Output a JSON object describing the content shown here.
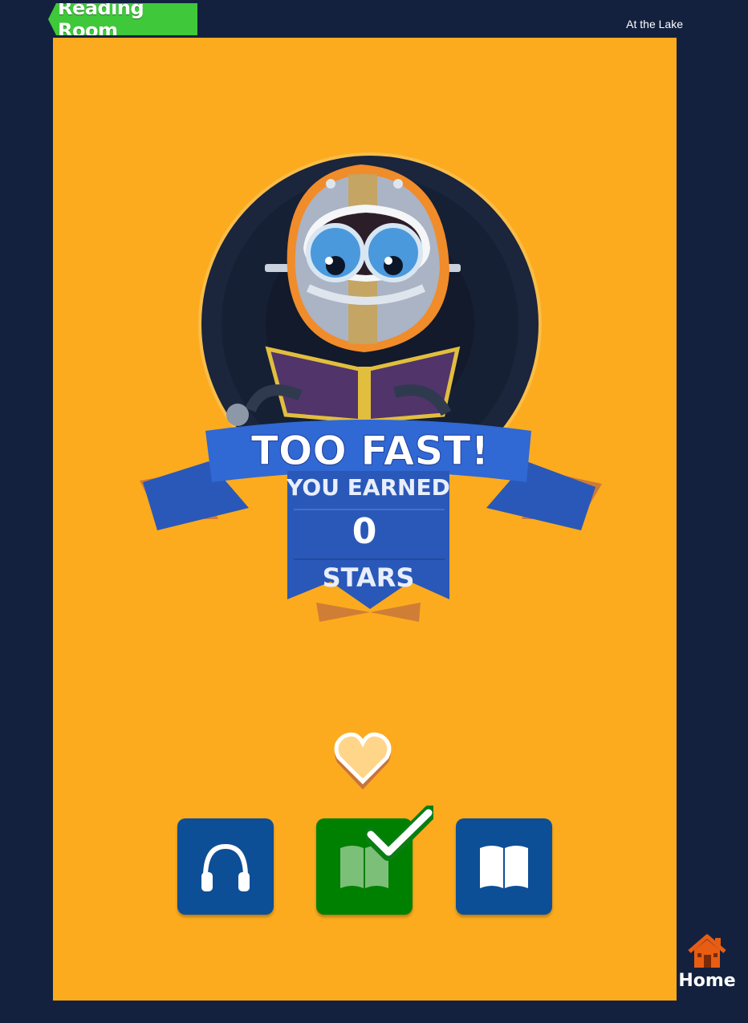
{
  "header": {
    "section_label": "Reading Room",
    "story_title": "At the Lake"
  },
  "result": {
    "headline": "TOO FAST!",
    "earned_label": "YOU EARNED",
    "stars_count": "0",
    "stars_label": "STARS"
  },
  "favorite": {
    "icon": "heart-icon",
    "selected": false
  },
  "modes": [
    {
      "name": "listen",
      "icon": "headphones-icon",
      "color": "#0d4f96",
      "completed": false
    },
    {
      "name": "read",
      "icon": "book-icon",
      "color": "#008000",
      "completed": true
    },
    {
      "name": "read-to",
      "icon": "open-book-icon",
      "color": "#0d4f96",
      "completed": false
    }
  ],
  "nav": {
    "home_label": "Home"
  },
  "colors": {
    "background": "#13213f",
    "panel": "#fcab1e",
    "tag": "#3ec83a",
    "ribbon": "#2d62c8",
    "home_icon": "#e85d12"
  }
}
